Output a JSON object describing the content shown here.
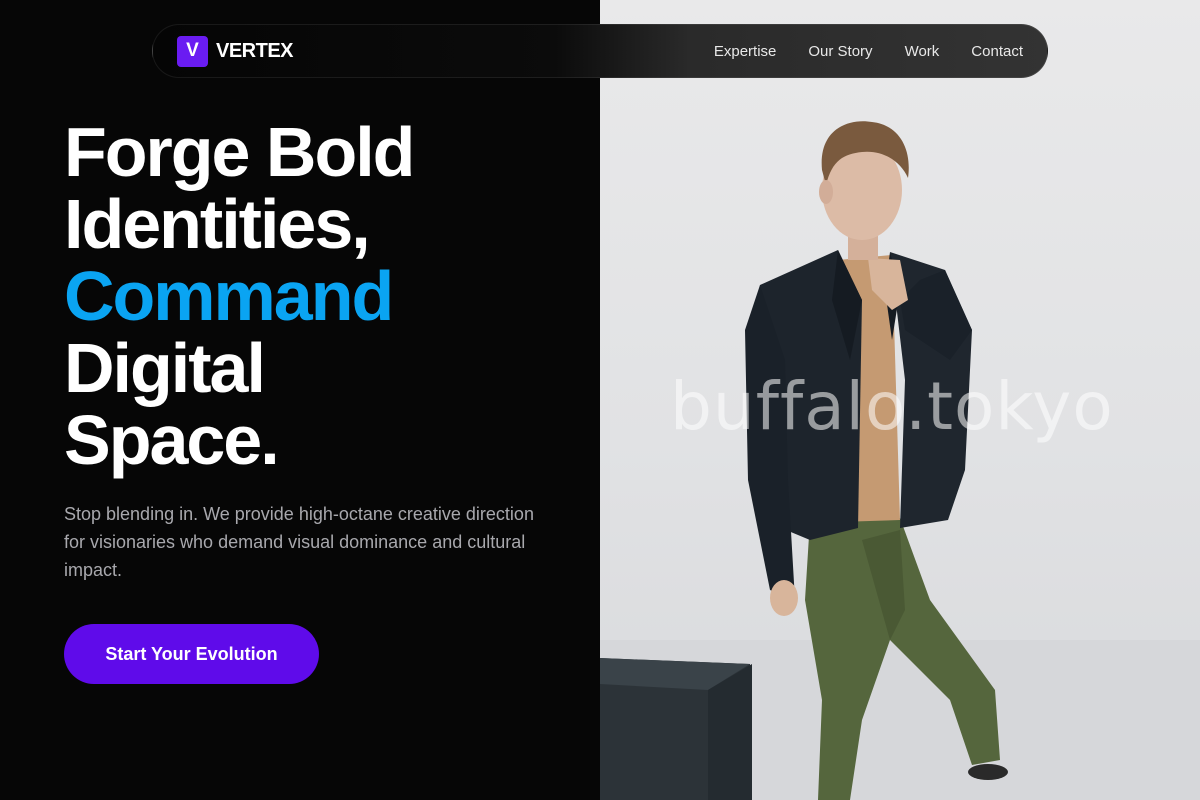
{
  "brand": {
    "logo_letter": "V",
    "name": "VERTEX",
    "accent_color": "#6a1cf2"
  },
  "nav": {
    "links": [
      "Expertise",
      "Our Story",
      "Work",
      "Contact"
    ]
  },
  "hero": {
    "title_lines": [
      "Forge Bold",
      "Identities,",
      "Command",
      "Digital",
      "Space."
    ],
    "highlight_line": "Command",
    "highlight_color": "#0aa4f2",
    "subtitle": "Stop blending in. We provide high-octane creative direction for visionaries who demand visual dominance and cultural impact.",
    "cta_label": "Start Your Evolution",
    "cta_color": "#5f0bea"
  },
  "photo": {
    "watermark": "buffalo.tokyo",
    "subject": "man-in-black-blazer-portrait"
  }
}
